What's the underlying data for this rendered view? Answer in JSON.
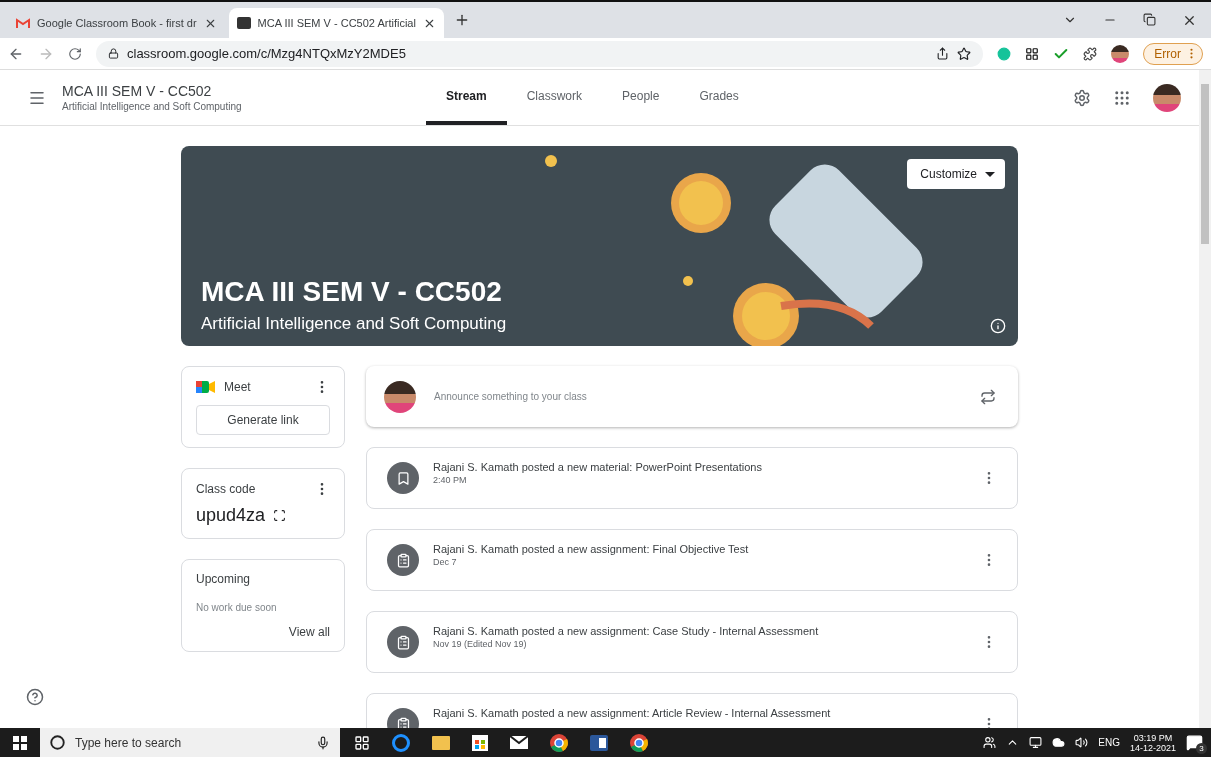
{
  "browser": {
    "tabs": [
      {
        "kind": "mail",
        "title": "Google Classroom Book - first dr",
        "selected": false
      },
      {
        "kind": "classroom",
        "title": "MCA III SEM V - CC502 Artificial",
        "selected": true
      }
    ],
    "url": "classroom.google.com/c/Mzg4NTQxMzY2MDE5",
    "profile_badge": "Error"
  },
  "header": {
    "title": "MCA III SEM V - CC502",
    "subtitle": "Artificial Intelligence and Soft Computing",
    "tabs": [
      {
        "label": "Stream",
        "selected": true
      },
      {
        "label": "Classwork",
        "selected": false
      },
      {
        "label": "People",
        "selected": false
      },
      {
        "label": "Grades",
        "selected": false
      }
    ]
  },
  "banner": {
    "title": "MCA III SEM V - CC502",
    "subtitle": "Artificial Intelligence and Soft Computing",
    "customize": "Customize"
  },
  "meet": {
    "title": "Meet",
    "button": "Generate link"
  },
  "class_code": {
    "label": "Class code",
    "code": "upud4za"
  },
  "upcoming": {
    "title": "Upcoming",
    "empty": "No work due soon",
    "link": "View all"
  },
  "announce": {
    "placeholder": "Announce something to your class"
  },
  "posts": [
    {
      "kind": "material",
      "text": "Rajani S. Kamath posted a new material: PowerPoint Presentations",
      "date": "2:40 PM"
    },
    {
      "kind": "assignment",
      "text": "Rajani S. Kamath posted a new assignment: Final Objective Test",
      "date": "Dec 7"
    },
    {
      "kind": "assignment",
      "text": "Rajani S. Kamath posted a new assignment: Case Study - Internal Assessment",
      "date": "Nov 19 (Edited Nov 19)"
    },
    {
      "kind": "assignment",
      "text": "Rajani S. Kamath posted a new assignment: Article Review - Internal Assessment"
    }
  ],
  "taskbar": {
    "search_placeholder": "Type here to search",
    "language": "ENG",
    "time": "03:19 PM",
    "date": "14-12-2021",
    "notifications": "3"
  }
}
